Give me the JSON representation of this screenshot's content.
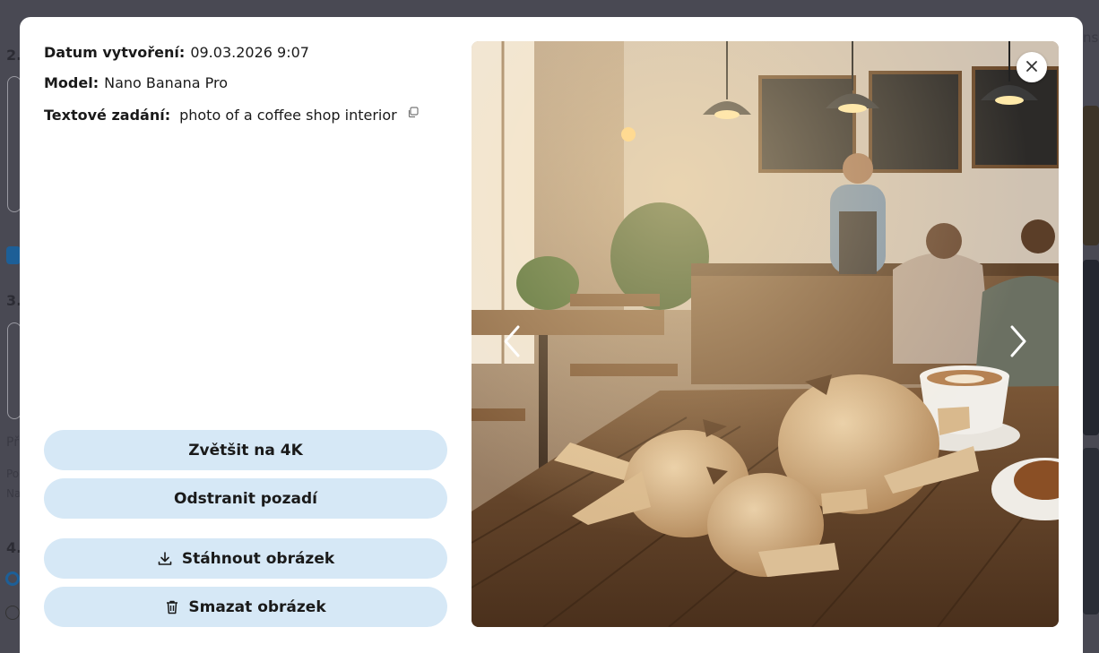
{
  "details": {
    "created_label": "Datum vytvoření:",
    "created_value": "09.03.2026 9:07",
    "model_label": "Model:",
    "model_value": "Nano Banana Pro",
    "prompt_label": "Textové zadání:",
    "prompt_value": "photo of a coffee shop interior"
  },
  "actions": {
    "upscale_label": "Zvětšit na 4K",
    "remove_bg_label": "Odstranit pozadí",
    "download_label": "Stáhnout obrázek",
    "delete_label": "Smazat obrázek"
  },
  "icons": {
    "copy": "copy-icon",
    "download": "download-icon",
    "trash": "trash-icon",
    "close": "close-icon",
    "prev": "chevron-left-icon",
    "next": "chevron-right-icon"
  },
  "colors": {
    "button_bg": "#d6e8f6",
    "overlay": "#505058"
  },
  "background": {
    "step2": "2.",
    "step3": "3.",
    "step4": "4.",
    "frag_pr": "Př",
    "frag_po": "Po",
    "frag_na": "Na",
    "frag_nsp": "nsp"
  }
}
